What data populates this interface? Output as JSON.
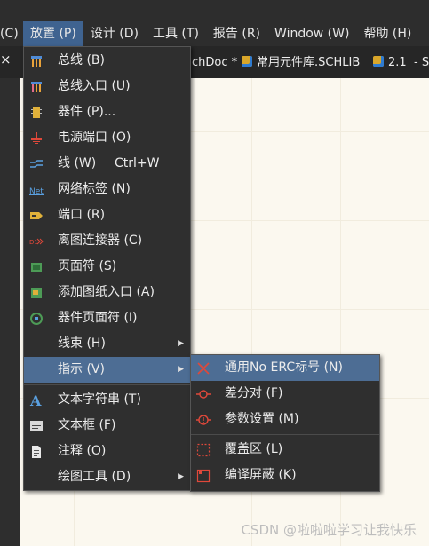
{
  "menubar": {
    "items": [
      {
        "label": "(C)"
      },
      {
        "label": "放置 (P)"
      },
      {
        "label": "设计 (D)"
      },
      {
        "label": "工具 (T)"
      },
      {
        "label": "报告 (R)"
      },
      {
        "label": "Window (W)"
      },
      {
        "label": "帮助 (H)"
      }
    ]
  },
  "tabs": [
    {
      "label": "chDoc *"
    },
    {
      "label": "常用元件库.SCHLIB"
    },
    {
      "label": "2.1"
    },
    {
      "label": "- S"
    }
  ],
  "left_panel": {
    "close_glyph": "×"
  },
  "place_menu": {
    "items": [
      {
        "label": "总线 (B)",
        "icon": "bus-icon"
      },
      {
        "label": "总线入口 (U)",
        "icon": "bus-entry-icon"
      },
      {
        "label": "器件 (P)...",
        "icon": "part-icon"
      },
      {
        "label": "电源端口 (O)",
        "icon": "power-port-icon"
      },
      {
        "label": "线 (W)",
        "shortcut": "Ctrl+W",
        "icon": "wire-icon"
      },
      {
        "label": "网络标签 (N)",
        "icon": "net-label-icon"
      },
      {
        "label": "端口 (R)",
        "icon": "port-icon"
      },
      {
        "label": "离图连接器 (C)",
        "icon": "off-sheet-connector-icon"
      },
      {
        "label": "页面符 (S)",
        "icon": "sheet-symbol-icon"
      },
      {
        "label": "添加图纸入口 (A)",
        "icon": "sheet-entry-icon"
      },
      {
        "label": "器件页面符 (I)",
        "icon": "device-sheet-symbol-icon"
      },
      {
        "label": "线束 (H)",
        "icon": "",
        "submenu": true
      },
      {
        "label": "指示 (V)",
        "icon": "",
        "submenu": true,
        "highlighted": true
      },
      {
        "label": "文本字符串 (T)",
        "icon": "text-string-icon"
      },
      {
        "label": "文本框 (F)",
        "icon": "text-frame-icon"
      },
      {
        "label": "注释 (O)",
        "icon": "note-icon"
      },
      {
        "label": "绘图工具 (D)",
        "icon": "",
        "submenu": true
      }
    ]
  },
  "directives_menu": {
    "items": [
      {
        "label": "通用No ERC标号 (N)",
        "icon": "no-erc-icon",
        "highlighted": true
      },
      {
        "label": "差分对 (F)",
        "icon": "differential-pair-icon"
      },
      {
        "label": "参数设置 (M)",
        "icon": "parameter-set-icon"
      },
      {
        "label": "覆盖区 (L)",
        "icon": "blanket-icon"
      },
      {
        "label": "编译屏蔽 (K)",
        "icon": "compile-mask-icon"
      }
    ]
  },
  "watermark": "CSDN @啦啦啦学习让我快乐",
  "colors": {
    "highlight": "#4d6d94",
    "menubar_active": "#3f6390",
    "canvas": "#fbf8ef",
    "accent_red": "#e0483a"
  }
}
